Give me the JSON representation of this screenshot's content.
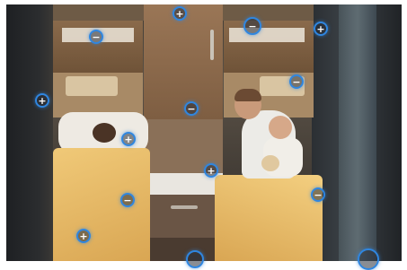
{
  "image": {
    "description_icon": "photo-icon"
  },
  "hotspots": [
    {
      "name": "plus-hotspot-1",
      "symbol": "+"
    },
    {
      "name": "minus-hotspot-1",
      "symbol": "−"
    },
    {
      "name": "minus-hotspot-2",
      "symbol": "−"
    },
    {
      "name": "plus-hotspot-2",
      "symbol": "+"
    },
    {
      "name": "plus-hotspot-3",
      "symbol": "+"
    },
    {
      "name": "minus-hotspot-3",
      "symbol": "−"
    },
    {
      "name": "minus-hotspot-4",
      "symbol": "−"
    },
    {
      "name": "plus-hotspot-4",
      "symbol": "+"
    },
    {
      "name": "plus-hotspot-5",
      "symbol": "+"
    },
    {
      "name": "minus-hotspot-5",
      "symbol": "−"
    },
    {
      "name": "minus-hotspot-6",
      "symbol": "−"
    },
    {
      "name": "plus-hotspot-6",
      "symbol": "+"
    },
    {
      "name": "hotspot-bottom-center",
      "symbol": ""
    },
    {
      "name": "hotspot-bottom-right",
      "symbol": ""
    }
  ],
  "colors": {
    "hotspot_ring": "#2f86e0",
    "blanket": "#e8b764",
    "wood": "#8a6a4b"
  }
}
